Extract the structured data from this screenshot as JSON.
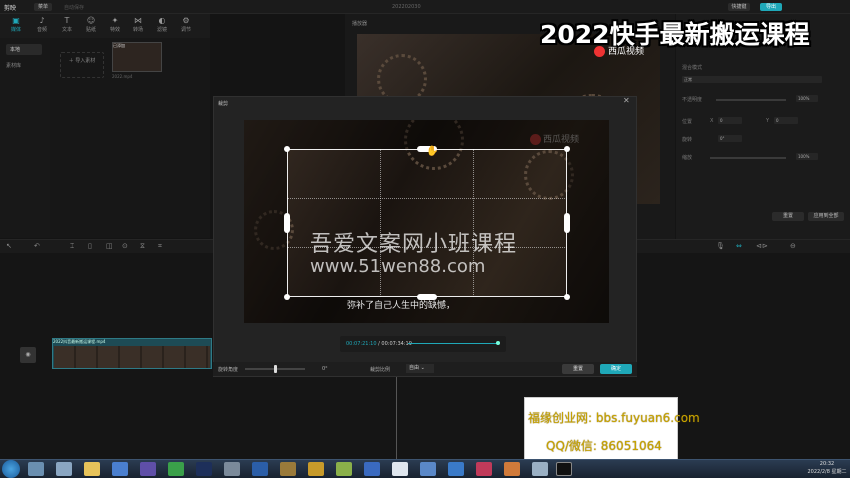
{
  "topbar": {
    "logo": "剪映",
    "menu": "菜单",
    "status": "自动保存 ",
    "project_title": "202202030",
    "shortcut": "快捷键",
    "export": "导出"
  },
  "tools": [
    {
      "label": "媒体",
      "icon": "▣"
    },
    {
      "label": "音频",
      "icon": "♪"
    },
    {
      "label": "文本",
      "icon": "T"
    },
    {
      "label": "贴纸",
      "icon": "☺"
    },
    {
      "label": "特效",
      "icon": "✦"
    },
    {
      "label": "转场",
      "icon": "⋈"
    },
    {
      "label": "滤镜",
      "icon": "◐"
    },
    {
      "label": "调节",
      "icon": "⚙"
    }
  ],
  "left_nav": [
    "本地",
    "素材库"
  ],
  "media": {
    "import_label": "导入素材",
    "thumb_label": "已添加",
    "thumb_name": "2022.mp4"
  },
  "preview": {
    "label": "播放器"
  },
  "right_panel": {
    "blend_label": "混合模式",
    "blend_value": "正常",
    "opacity_label": "不透明度",
    "opacity_value": "100%",
    "position_label": "位置",
    "x_label": "X",
    "x_value": "0",
    "y_label": "Y",
    "y_value": "0",
    "rotate_label": "旋转",
    "rotate_value": "0°",
    "scale_label": "缩放",
    "scale_value": "100%",
    "reset_label": "重置",
    "apply_all_label": "应用到全部"
  },
  "timeline": {
    "clip_name": "2022抖音最新搬运课程.mp4",
    "cover_label": "封面"
  },
  "modal": {
    "title": "裁剪",
    "close": "✕",
    "watermark_main": "吾爱文案网小班课程",
    "watermark_url": "www.51wen88.com",
    "subtitle": "弥补了自己人生中的缺憾，",
    "xigua": "西瓜视频",
    "time_current": "00:07:21:10",
    "time_total": "00:07:34:19",
    "rotate_label": "旋转角度",
    "rotate_value": "0°",
    "ratio_label": "裁剪比例",
    "ratio_value": "自由",
    "reset_label": "重置",
    "confirm_label": "确定"
  },
  "overlay": {
    "banner": "2022快手最新搬运课程",
    "xigua": "西瓜视频"
  },
  "ad": {
    "site": "福缘创业网: bbs.fuyuan6.com",
    "qq": "QQ/微信: 86051064"
  },
  "taskbar": {
    "time": "20:32",
    "date": "2022/2/8 星期二"
  },
  "colors": {
    "accent": "#1fa8b8",
    "banner_text": "#ffffff",
    "ad_text": "#c8a400"
  }
}
